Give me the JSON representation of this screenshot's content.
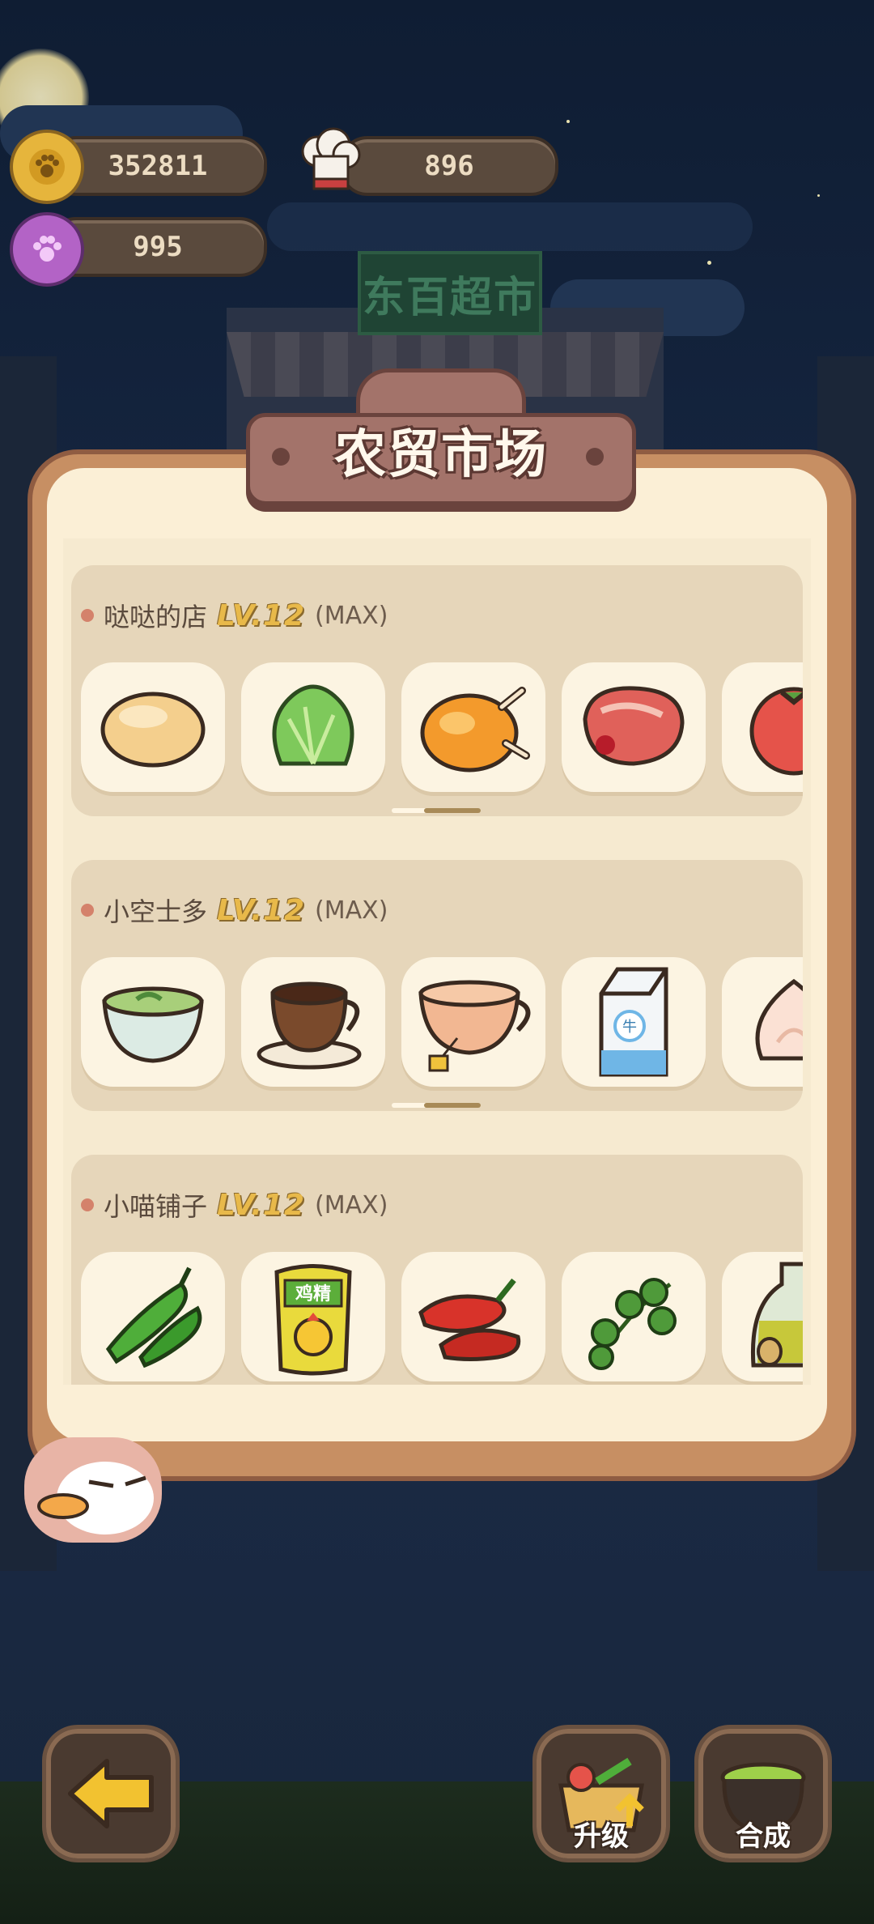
{
  "hud": {
    "coins": "352811",
    "chef_tokens": "896",
    "paw_gems": "995"
  },
  "background": {
    "store_sign": "东百超市"
  },
  "market": {
    "title": "农贸市场",
    "shops": [
      {
        "name": "哒哒的店",
        "level": "LV.12",
        "max": "(MAX)",
        "items": [
          "dough-icon",
          "lettuce-icon",
          "roast-chicken-icon",
          "steak-icon",
          "tomato-icon"
        ]
      },
      {
        "name": "小空士多",
        "level": "LV.12",
        "max": "(MAX)",
        "items": [
          "green-tea-icon",
          "coffee-icon",
          "black-tea-icon",
          "milk-carton-icon",
          "cream-icon"
        ]
      },
      {
        "name": "小喵铺子",
        "level": "LV.12",
        "max": "(MAX)",
        "items": [
          "green-pepper-icon",
          "chicken-essence-icon",
          "red-pepper-icon",
          "cilantro-icon",
          "oil-bottle-icon"
        ]
      }
    ],
    "chicken_essence_label": "鸡精",
    "milk_label": "牛"
  },
  "bottom_bar": {
    "back_icon": "arrow-left-icon",
    "upgrade_label": "升级",
    "craft_label": "合成"
  },
  "colors": {
    "panel_border": "#c78f63",
    "panel_fill": "#fbefd6",
    "title_plate": "#a3736a",
    "level_gold": "#e8b94a"
  }
}
